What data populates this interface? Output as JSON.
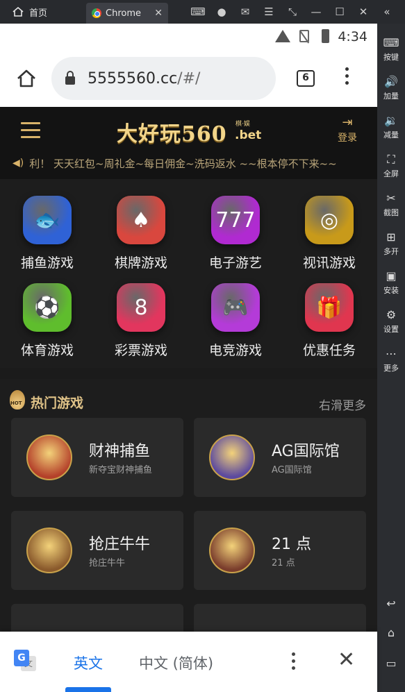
{
  "window": {
    "home_tab_label": "首页",
    "browser_tab_label": "Chrome",
    "tab_close": "✕"
  },
  "emulator_sidebar": [
    {
      "label": "按键",
      "icon": "keyboard-icon"
    },
    {
      "label": "加量",
      "icon": "volume-up-icon"
    },
    {
      "label": "减量",
      "icon": "volume-down-icon"
    },
    {
      "label": "全屏",
      "icon": "fullscreen-icon"
    },
    {
      "label": "截图",
      "icon": "scissors-icon"
    },
    {
      "label": "多开",
      "icon": "multi-instance-icon"
    },
    {
      "label": "安装",
      "icon": "apk-install-icon"
    },
    {
      "label": "设置",
      "icon": "settings-icon"
    },
    {
      "label": "更多",
      "icon": "more-icon"
    }
  ],
  "status_bar": {
    "time": "4:34"
  },
  "browser": {
    "url_host": "5555560.cc",
    "url_path": "/#/",
    "tab_count": "6"
  },
  "site": {
    "logo_main": "大好玩560",
    "logo_badge": "棋·娱",
    "logo_suffix": ".bet",
    "login_label": "登录",
    "marquee": "利！ 天天红包~周礼金~每日佣金~洗码返水 ~~根本停不下来~~",
    "categories": [
      {
        "label": "捕鱼游戏",
        "icon": "fish-game-icon",
        "glyph": "🐟",
        "color": "#2f62d6"
      },
      {
        "label": "棋牌游戏",
        "icon": "card-game-icon",
        "glyph": "♠",
        "color": "#d9473e"
      },
      {
        "label": "电子游艺",
        "icon": "slot-machine-icon",
        "glyph": "777",
        "color": "#b02ad1"
      },
      {
        "label": "视讯游戏",
        "icon": "roulette-icon",
        "glyph": "◎",
        "color": "#c89a1a"
      },
      {
        "label": "体育游戏",
        "icon": "soccer-ball-icon",
        "glyph": "⚽",
        "color": "#5fbd2d"
      },
      {
        "label": "彩票游戏",
        "icon": "lottery-ball-icon",
        "glyph": "8",
        "color": "#e2365e"
      },
      {
        "label": "电竞游戏",
        "icon": "gamepad-icon",
        "glyph": "🎮",
        "color": "#b43bd8"
      },
      {
        "label": "优惠任务",
        "icon": "gift-icon",
        "glyph": "🎁",
        "color": "#e0364f"
      }
    ],
    "hot": {
      "title": "热门游戏",
      "badge": "HOT",
      "more": "右滑更多",
      "games": [
        {
          "name": "财神捕鱼",
          "desc": "新夺宝财神捕鱼",
          "color": "#b4412a"
        },
        {
          "name": "AG国际馆",
          "desc": "AG国际馆",
          "color": "#5c4a9e"
        },
        {
          "name": "抢庄牛牛",
          "desc": "抢庄牛牛",
          "color": "#8a5a2c"
        },
        {
          "name": "21 点",
          "desc": "21 点",
          "color": "#7a3d2c"
        }
      ]
    }
  },
  "translate_bar": {
    "lang_source": "英文",
    "lang_target": "中文 (简体)"
  }
}
